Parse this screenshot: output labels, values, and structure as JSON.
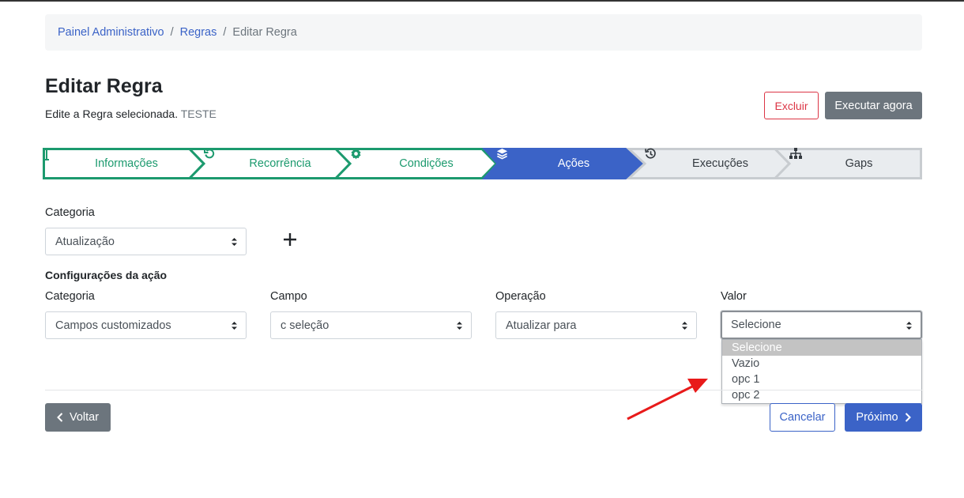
{
  "breadcrumb": {
    "items": [
      "Painel Administrativo",
      "Regras"
    ],
    "separator": "/",
    "current": "Editar Regra"
  },
  "header": {
    "title": "Editar Regra",
    "subtitle": "Edite a Regra selecionada.",
    "subtitle_tag": "TESTE",
    "delete_label": "Excluir",
    "run_label": "Executar agora"
  },
  "stepper": {
    "steps": [
      {
        "label": "Informações",
        "icon": "text-cursor-icon",
        "state": "done"
      },
      {
        "label": "Recorrência",
        "icon": "undo-icon",
        "state": "done"
      },
      {
        "label": "Condições",
        "icon": "gear-icon",
        "state": "done"
      },
      {
        "label": "Ações",
        "icon": "layers-icon",
        "state": "active"
      },
      {
        "label": "Execuções",
        "icon": "history-icon",
        "state": "pending"
      },
      {
        "label": "Gaps",
        "icon": "sitemap-icon",
        "state": "pending"
      }
    ]
  },
  "form": {
    "categoria_label": "Categoria",
    "categoria_value": "Atualização",
    "config_heading": "Configurações da ação",
    "fields": {
      "categoria_label": "Categoria",
      "categoria_value": "Campos customizados",
      "campo_label": "Campo",
      "campo_value": "c seleção",
      "operacao_label": "Operação",
      "operacao_value": "Atualizar para",
      "valor_label": "Valor",
      "valor_value": "Selecione"
    },
    "valor_options": [
      "Selecione",
      "Vazio",
      "opc 1",
      "opc 2"
    ],
    "valor_selected_index": 0
  },
  "footer": {
    "back_label": "Voltar",
    "cancel_label": "Cancelar",
    "next_label": "Próximo"
  },
  "colors": {
    "done": "#1c9a6e",
    "active": "#3b63c7",
    "pending_bg": "#e9ecef",
    "pending_border": "#c8ccd0",
    "danger": "#dc3545",
    "secondary": "#6c757d",
    "annotation_arrow": "#e81a1a"
  }
}
